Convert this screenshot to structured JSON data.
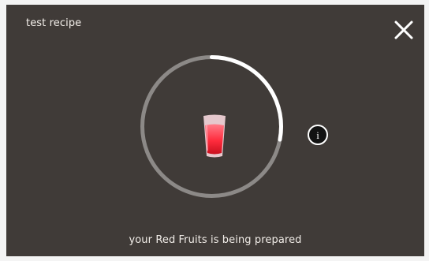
{
  "header": {
    "title": "test recipe",
    "close_icon": "close-icon"
  },
  "progress": {
    "value": 0.28,
    "icon": "drink-cup-icon"
  },
  "info_button": {
    "label": "i",
    "icon": "info-icon"
  },
  "status": {
    "message": "your Red Fruits is being prepared"
  },
  "colors": {
    "background": "#403b38",
    "progress_track": "#8c8987",
    "progress_fill": "#ffffff",
    "drink": "#ff2c3d",
    "text": "#f1ede8"
  }
}
